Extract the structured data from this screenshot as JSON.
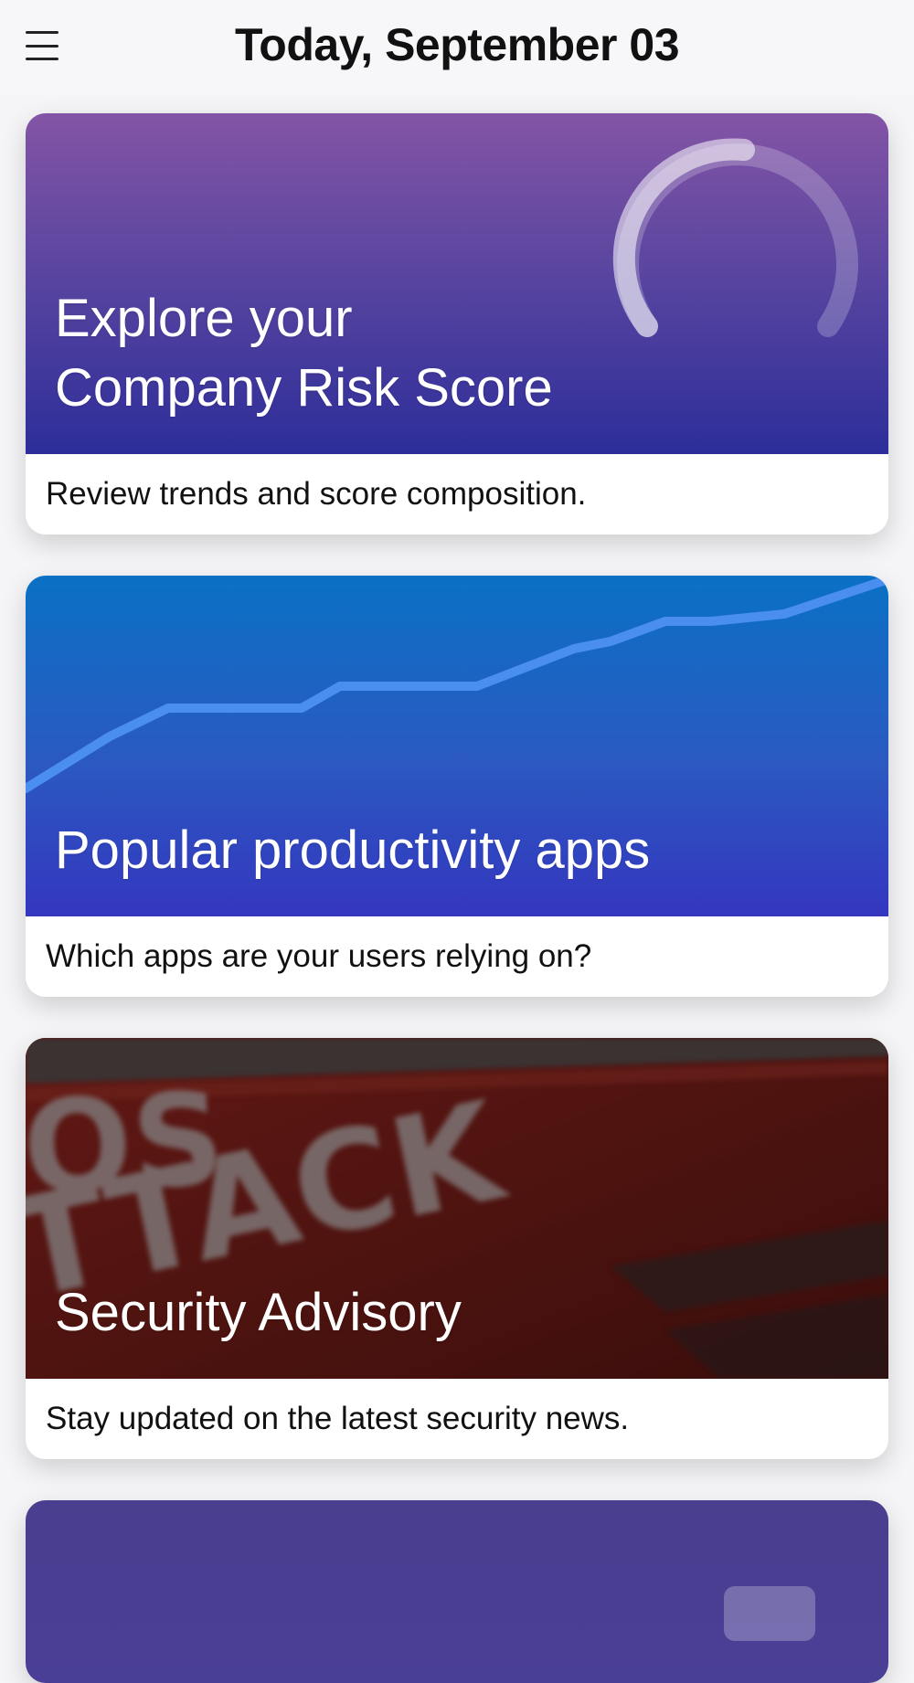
{
  "header": {
    "title": "Today, September 03",
    "menu_icon": "hamburger-menu-icon"
  },
  "cards": [
    {
      "title_line1": "Explore your",
      "title_line2": "Company Risk Score",
      "caption": "Review trends and score composition.",
      "illustration": "gauge-arc"
    },
    {
      "title": "Popular productivity apps",
      "caption": "Which apps are your users relying on?",
      "illustration": "trend-line"
    },
    {
      "title": "Security Advisory",
      "caption": "Stay updated on the latest security news.",
      "illustration": "ddos-attack-keyboard-photo",
      "image_text": [
        "OS",
        "TTACK"
      ]
    },
    {
      "illustration": "purple-card-partial"
    }
  ],
  "colors": {
    "card1_top": "#8354a5",
    "card1_bottom": "#2d2e9a",
    "card2_top": "#0a71c4",
    "card2_bottom": "#3436bf",
    "card3_bg": "#4b1411",
    "card4_bg": "#4a3e8f"
  }
}
